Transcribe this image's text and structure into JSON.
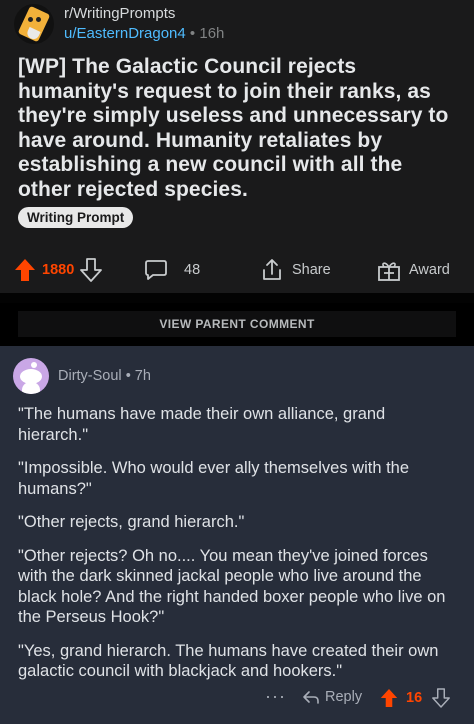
{
  "post": {
    "subreddit": "r/WritingPrompts",
    "author": "u/EasternDragon4",
    "separator": "•",
    "age": "16h",
    "title": "[WP] The Galactic Council rejects humanity's request to join their ranks, as they're simply useless and unnecessary to have around. Humanity retaliates by establishing a new council with all the other rejected species.",
    "flair": "Writing Prompt",
    "votes": "1880",
    "comments": "48",
    "share_label": "Share",
    "award_label": "Award",
    "upvoted": true
  },
  "view_parent_label": "VIEW PARENT COMMENT",
  "comment": {
    "username": "Dirty-Soul",
    "separator": "•",
    "age": "7h",
    "paragraphs": [
      "\"The humans have made their own alliance, grand hierarch.\"",
      "\"Impossible. Who would ever ally themselves with the humans?\"",
      "\"Other rejects, grand hierarch.\"",
      "\"Other rejects? Oh no.... You mean they've joined forces with the dark skinned jackal people who live around the black hole? And the right handed boxer people who live on the Perseus Hook?\"",
      "\"Yes, grand hierarch. The humans have created their own galactic council with blackjack and hookers.\""
    ],
    "more_label": "···",
    "reply_label": "Reply",
    "votes": "16",
    "upvoted": true
  },
  "colors": {
    "accent_upvote": "#ff4500",
    "username_link": "#4fbcff",
    "post_bg": "#1a1a1b",
    "comment_bg": "#272d3a"
  },
  "icons": [
    "subreddit-avatar-icon",
    "upvote-arrow-icon",
    "downvote-arrow-icon",
    "comment-bubble-icon",
    "share-icon",
    "award-icon",
    "snoo-avatar-icon",
    "more-dots-icon",
    "reply-arrow-icon"
  ]
}
